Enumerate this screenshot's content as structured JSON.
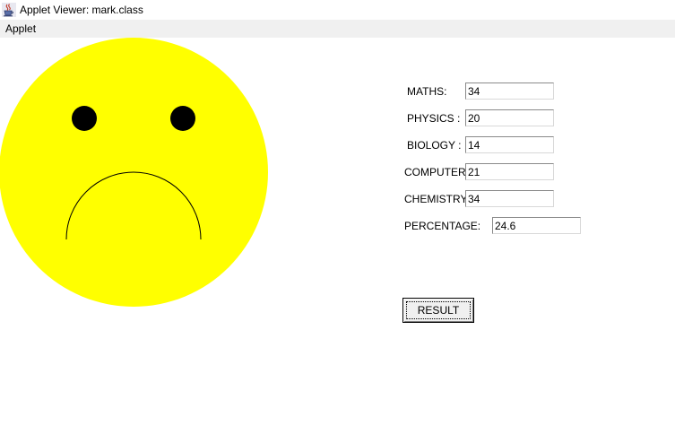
{
  "window": {
    "title": "Applet Viewer: mark.class"
  },
  "menu": {
    "items": [
      "Applet"
    ]
  },
  "face": {
    "fill_color": "#ffff00",
    "eye_color": "#000000",
    "mouth_color": "#000000",
    "expression": "sad"
  },
  "form": {
    "maths": {
      "label": "MATHS:",
      "value": "34"
    },
    "physics": {
      "label": "PHYSICS :",
      "value": "20"
    },
    "biology": {
      "label": "BIOLOGY :",
      "value": "14"
    },
    "computer": {
      "label": "COMPUTER",
      "value": "21"
    },
    "chemistry": {
      "label": "CHEMISTRY",
      "value": "34"
    },
    "percentage": {
      "label": "PERCENTAGE:",
      "value": "24.6"
    }
  },
  "result_button": {
    "label": "RESULT"
  }
}
